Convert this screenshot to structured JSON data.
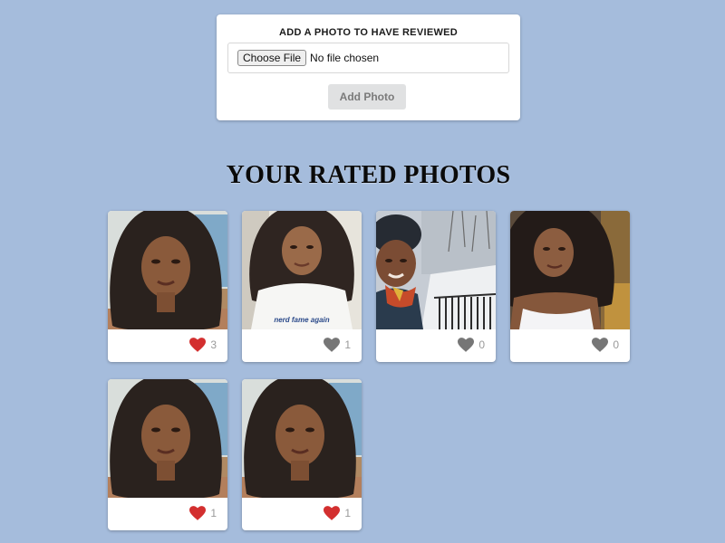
{
  "upload": {
    "heading": "ADD A PHOTO TO HAVE REVIEWED",
    "choose_label": "Choose File",
    "file_status": "No file chosen",
    "add_label": "Add Photo"
  },
  "gallery": {
    "title": "YOUR RATED PHOTOS",
    "photos": [
      {
        "count": "3",
        "liked": true,
        "scene": "portrait-window",
        "shirt": ""
      },
      {
        "count": "1",
        "liked": false,
        "scene": "portrait-white-tee",
        "shirt": "nerd fame again"
      },
      {
        "count": "0",
        "liked": false,
        "scene": "winter-snow",
        "shirt": ""
      },
      {
        "count": "0",
        "liked": false,
        "scene": "portrait-tank-top",
        "shirt": ""
      },
      {
        "count": "1",
        "liked": true,
        "scene": "portrait-window",
        "shirt": ""
      },
      {
        "count": "1",
        "liked": true,
        "scene": "portrait-window",
        "shirt": ""
      }
    ]
  },
  "colors": {
    "background": "#a5bcdc",
    "heart_liked": "#d32f2f",
    "heart_unliked": "#767676"
  },
  "icons": {
    "rating": "heart-icon",
    "photo": "photo-thumbnail"
  }
}
